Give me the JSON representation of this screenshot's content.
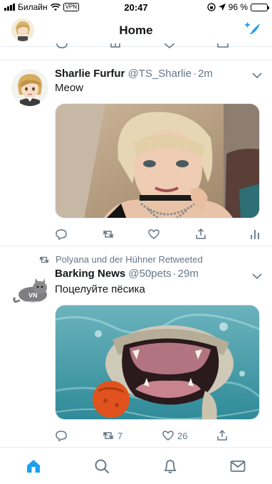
{
  "status_bar": {
    "carrier": "Билайн",
    "vpn": "VPN",
    "time": "20:47",
    "battery": "96 %",
    "battery_level": 0.96
  },
  "header": {
    "title": "Home"
  },
  "tweets": [
    {
      "name": "Sharlie Furfur",
      "handle": "@TS_Sharlie",
      "separator": "·",
      "time": "2m",
      "text": "Meow",
      "actions": {
        "reply": "",
        "retweet": "",
        "like": "",
        "share": ""
      }
    },
    {
      "retweeted_by": "Polyana und der Hühner Retweeted",
      "name": "Barking News",
      "handle": "@50pets",
      "separator": "·",
      "time": "29m",
      "text": "Поцелуйте пёсика",
      "actions": {
        "reply": "",
        "retweet": "7",
        "like": "26",
        "share": ""
      }
    }
  ],
  "colors": {
    "accent": "#1da1f2",
    "secondary_text": "#657786",
    "divider": "#e6ecf0"
  },
  "tabbar": {
    "items": [
      "home-icon",
      "search-icon",
      "bell-icon",
      "mail-icon"
    ],
    "active": "home-icon"
  }
}
